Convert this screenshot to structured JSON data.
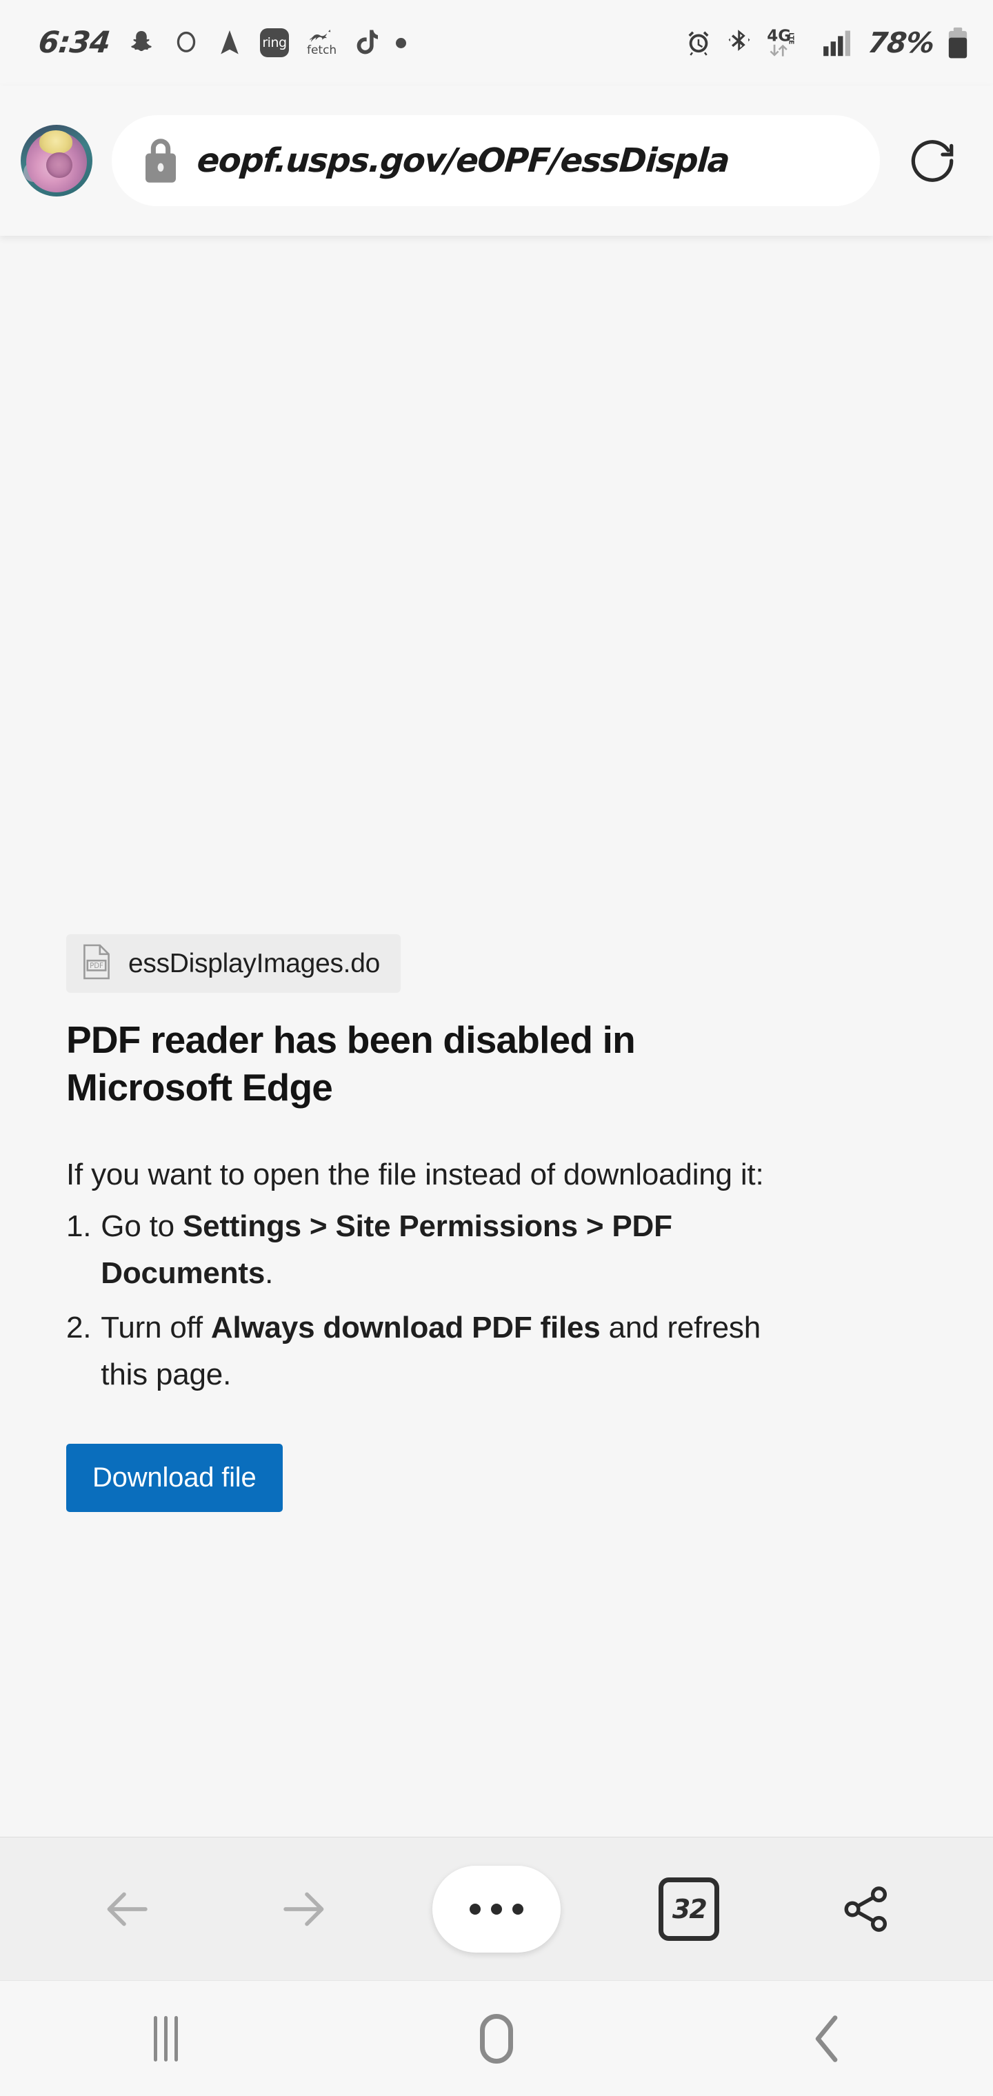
{
  "status_bar": {
    "time": "6:34",
    "left_icons": [
      {
        "name": "snapchat-icon",
        "label": "Snapchat"
      },
      {
        "name": "alexa-icon",
        "label": "Alexa"
      },
      {
        "name": "navigation-arrow-icon",
        "label": "Navigation"
      },
      {
        "name": "ring-app-icon",
        "label": "ring"
      },
      {
        "name": "fetch-app-icon",
        "label": "fetch"
      },
      {
        "name": "tiktok-icon",
        "label": "TikTok"
      },
      {
        "name": "notification-dot-icon",
        "label": "Notification"
      }
    ],
    "right_icons": [
      {
        "name": "alarm-icon",
        "label": "Alarm set"
      },
      {
        "name": "bluetooth-icon",
        "label": "Bluetooth on"
      },
      {
        "name": "network-4g-lte-icon",
        "label": "4G LTE"
      },
      {
        "name": "signal-bars-icon",
        "label": "Signal strength"
      }
    ],
    "network_type": "4G",
    "network_subtype": "LTE",
    "battery_percent": "78%"
  },
  "browser": {
    "avatar_label": "Profile picture",
    "url": "eopf.usps.gov/eOPF/essDispla",
    "url_full_visible": "eopf.usps.gov/eOPF/essDisplay",
    "secure": true,
    "lock_label": "Connection is secure",
    "reload_label": "Reload page"
  },
  "page": {
    "file_chip": {
      "icon": "pdf-file-icon",
      "filename": "essDisplayImages.do"
    },
    "title": "PDF reader has been disabled in Microsoft Edge",
    "intro": "If you want to open the file instead of downloading it:",
    "steps": [
      {
        "number": "1.",
        "parts": [
          {
            "text": "Go to ",
            "bold": false
          },
          {
            "text": "Settings > Site Permissions > PDF Documents",
            "bold": true
          },
          {
            "text": ".",
            "bold": false
          }
        ]
      },
      {
        "number": "2.",
        "parts": [
          {
            "text": "Turn off ",
            "bold": false
          },
          {
            "text": "Always download PDF files",
            "bold": true
          },
          {
            "text": " and refresh this page.",
            "bold": false
          }
        ]
      }
    ],
    "download_button": "Download file",
    "accent_color": "#0a6ebd"
  },
  "bottom_toolbar": {
    "back_label": "Back",
    "forward_label": "Forward",
    "menu_label": "More options",
    "tab_count": "32",
    "tabs_label": "Tabs",
    "share_label": "Share"
  },
  "android_nav": {
    "recents_label": "Recent apps",
    "home_label": "Home",
    "back_label": "Back"
  }
}
